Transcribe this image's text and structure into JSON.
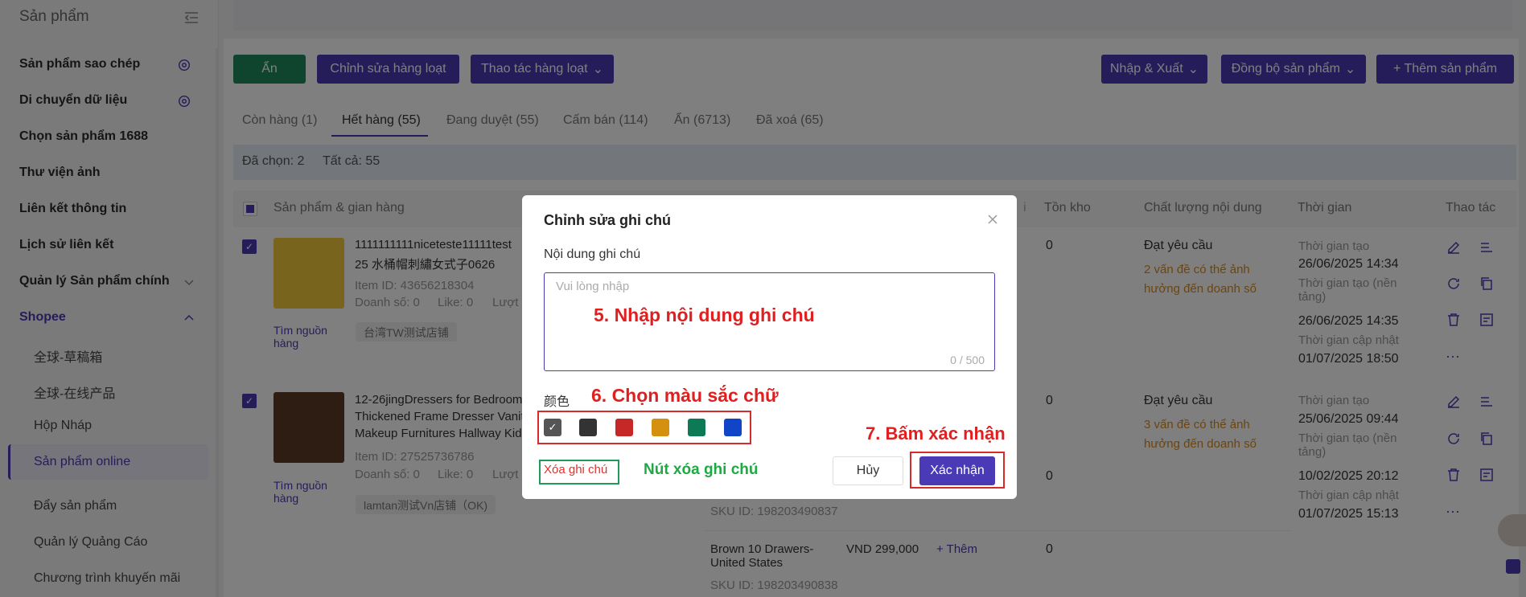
{
  "sidebar": {
    "title": "Sản phẩm",
    "items": [
      {
        "label": "Sản phẩm sao chép",
        "icon": "gear-icon"
      },
      {
        "label": "Di chuyển dữ liệu",
        "icon": "gear-icon"
      },
      {
        "label": "Chọn sản phẩm 1688"
      },
      {
        "label": "Thư viện ảnh"
      },
      {
        "label": "Liên kết thông tin"
      },
      {
        "label": "Lịch sử liên kết"
      },
      {
        "label": "Quản lý Sản phẩm chính",
        "icon": "chevron-down-icon"
      },
      {
        "label": "Shopee",
        "icon": "chevron-up-icon"
      }
    ],
    "subitems": [
      "全球-草稿箱",
      "全球-在线产品",
      "Hộp Nháp",
      "Sản phẩm online",
      "Đẩy sản phẩm",
      "Quản lý Quảng Cáo",
      "Chương trình khuyến mãi"
    ],
    "active": "Sản phẩm online"
  },
  "toolbar": {
    "hide_label": "Ẩn",
    "bulk_edit_label": "Chỉnh sửa hàng loạt",
    "bulk_action_label": "Thao tác hàng loạt",
    "import_export_label": "Nhập & Xuất",
    "sync_label": "Đồng bộ sản phẩm",
    "add_label": "+ Thêm sản phẩm"
  },
  "tabs": [
    "Còn hàng (1)",
    "Hết hàng (55)",
    "Đang duyệt (55)",
    "Cấm bán (114)",
    "Ẩn (6713)",
    "Đã xoá (65)"
  ],
  "selection": {
    "selected": "Đã chọn: 2",
    "total": "Tất cả: 55"
  },
  "table": {
    "headers": [
      "Sản phẩm & gian hàng",
      "i",
      "Tồn kho",
      "Chất lượng nội dung",
      "Thời gian",
      "Thao tác"
    ],
    "rows": [
      {
        "title": "1111111111niceteste11111test",
        "title2": "25 水桶帽刺繡女式子0626",
        "item_id": "Item ID: 43656218304",
        "sales": "Doanh số: 0",
        "likes": "Like: 0",
        "views": "Lượt x",
        "source": "Tìm nguồn hàng",
        "shop": "台湾TW测试店铺",
        "stock": "0",
        "quality": "Đạt yêu cầu",
        "quality_note": "2 vấn đề có thể ảnh hưởng đến doanh số",
        "time_created_label": "Thời gian tạo",
        "time_created": "26/06/2025 14:34",
        "time_platform_label": "Thời gian tạo (nền tảng)",
        "time_platform": "26/06/2025 14:35",
        "time_updated_label": "Thời gian cập nhật",
        "time_updated": "01/07/2025 18:50"
      },
      {
        "title": "12-26jingDressers for Bedroom",
        "title2": "Thickened Frame Dresser Vanity",
        "title3": "Makeup Furnitures Hallway Kids",
        "item_id": "Item ID: 27525736786",
        "sales": "Doanh số: 0",
        "likes": "Like: 0",
        "views": "Lượt x",
        "source": "Tìm nguồn hàng",
        "shop": "lamtan测试Vn店铺（OK)",
        "stock": "0",
        "stock2": "0",
        "quality": "Đạt yêu cầu",
        "quality_note": "3 vấn đề có thể ảnh hưởng đến doanh số",
        "time_created_label": "Thời gian tạo",
        "time_created": "25/06/2025 09:44",
        "time_platform_label": "Thời gian tạo (nền tảng)",
        "time_platform": "10/02/2025 20:12",
        "time_updated_label": "Thời gian cập nhật",
        "time_updated": "01/07/2025 15:13",
        "sku1": "SKU ID: 198203490837",
        "variant2_name": "Brown 10 Drawers-United States",
        "variant2_price": "VND 299,000",
        "variant2_more": "+ Thêm",
        "variant2_stock": "0",
        "sku2": "SKU ID: 198203490838"
      }
    ]
  },
  "modal": {
    "title": "Chỉnh sửa ghi chú",
    "note_label": "Nội dung ghi chú",
    "placeholder": "Vui lòng nhập",
    "counter": "0 / 500",
    "color_label": "颜色",
    "colors": [
      "#555555",
      "#333333",
      "#c62828",
      "#d4900f",
      "#0b7a55",
      "#1145c8"
    ],
    "clear_label": "Xóa ghi chú",
    "cancel_label": "Hủy",
    "confirm_label": "Xác nhận"
  },
  "annotations": {
    "step5": "5. Nhập nội dung ghi chú",
    "step6": "6. Chọn màu sắc chữ",
    "step7": "7. Bấm xác nhận",
    "clear_note": "Nút xóa ghi chú"
  }
}
